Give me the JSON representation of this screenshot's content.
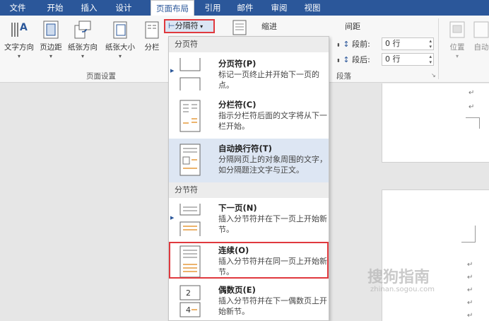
{
  "tabs": [
    {
      "label": "文件"
    },
    {
      "label": "开始"
    },
    {
      "label": "插入"
    },
    {
      "label": "设计"
    },
    {
      "label": "页面布局"
    },
    {
      "label": "引用"
    },
    {
      "label": "邮件"
    },
    {
      "label": "审阅"
    },
    {
      "label": "视图"
    }
  ],
  "ribbon": {
    "text_direction": "文字方向",
    "margins": "页边距",
    "orientation": "纸张方向",
    "size": "纸张大小",
    "columns": "分栏",
    "page_setup_label": "页面设置",
    "breaks_label": "分隔符",
    "indent_label": "缩进",
    "spacing_label": "间距",
    "before_label": "段前:",
    "before_value": "0 行",
    "after_label": "段后:",
    "after_value": "0 行",
    "paragraph_label": "段落",
    "position_label": "位置",
    "wrap_label": "自动"
  },
  "menu": {
    "section_page": "分页符",
    "section_section": "分节符",
    "items": [
      {
        "title": "分页符(P)",
        "desc": "标记一页终止并开始下一页的点。"
      },
      {
        "title": "分栏符(C)",
        "desc": "指示分栏符后面的文字将从下一栏开始。"
      },
      {
        "title": "自动换行符(T)",
        "desc": "分隔网页上的对象周围的文字，如分隔题注文字与正文。"
      },
      {
        "title": "下一页(N)",
        "desc": "插入分节符并在下一页上开始新节。"
      },
      {
        "title": "连续(O)",
        "desc": "插入分节符并在同一页上开始新节。"
      },
      {
        "title": "偶数页(E)",
        "desc": "插入分节符并在下一偶数页上开始新节。"
      }
    ]
  },
  "watermark": {
    "main": "搜狗指南",
    "sub": "zhinan.sogou.com"
  },
  "colors": {
    "accent": "#2b579a",
    "highlight": "#e0393e",
    "hover": "#dde6f3"
  }
}
